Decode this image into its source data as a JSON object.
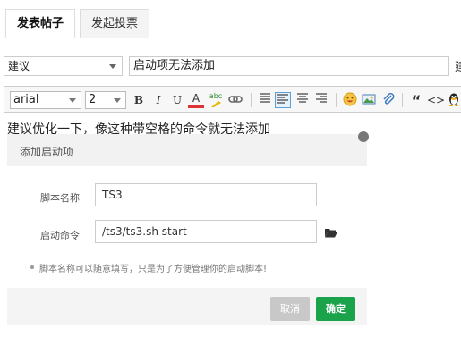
{
  "tabs": [
    {
      "label": "发表帖子",
      "active": true
    },
    {
      "label": "发起投票",
      "active": false
    }
  ],
  "post": {
    "category": "建议",
    "title": "启动项无法添加",
    "overflow_char": "建"
  },
  "editor": {
    "font": "arial",
    "size": "2",
    "buttons": {
      "bold": "B",
      "italic": "I",
      "underline": "U",
      "font_color": "A",
      "spell": "abc",
      "quote": "“",
      "code": "<>"
    },
    "body_text": "建议优化一下，像这种带空格的命令就无法添加"
  },
  "dialog": {
    "title": "添加启动项",
    "script_name_label": "脚本名称",
    "script_name_value": "TS3",
    "start_cmd_label": "启动命令",
    "start_cmd_value": "/ts3/ts3.sh start",
    "note": "脚本名称可以随意填写，只是为了方便管理你的启动脚本!",
    "cancel_label": "取消",
    "ok_label": "确定"
  },
  "colors": {
    "ok_button": "#1aa34a",
    "cancel_button": "#c8c8c8",
    "active_align": "#5aa0d6"
  }
}
